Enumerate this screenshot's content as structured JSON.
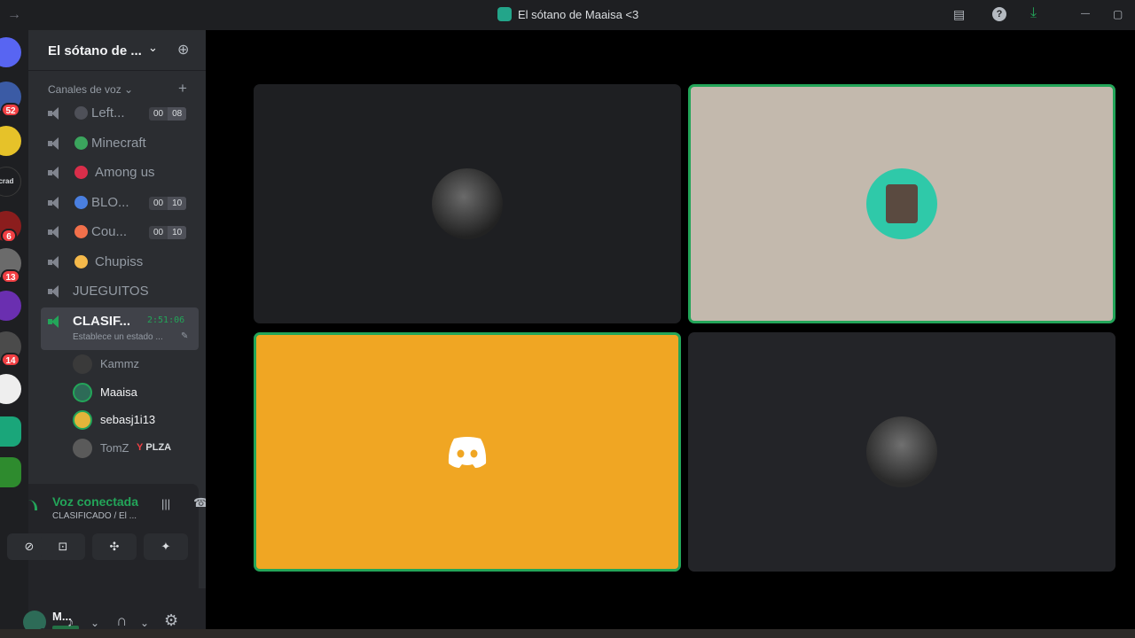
{
  "window": {
    "title": "El sótano de Maaisa <3",
    "back_glyph": "→",
    "inbox_glyph": "▤",
    "help_glyph": "?",
    "download_glyph": "⤓",
    "minimize_glyph": "—",
    "maximize_glyph": "▢"
  },
  "servers": {
    "badges": [
      "52",
      "6",
      "13",
      "14"
    ],
    "partial_label": "ecrad",
    "colors": [
      "#3b5ba5",
      "#e6c229",
      "#8b1d1d",
      "#6b6b6b",
      "#6a2fb0",
      "#4b4b4b",
      "#eeeeee",
      "#1aa67a",
      "#2e8b2e"
    ]
  },
  "server": {
    "name": "El sótano de ...",
    "chevron_glyph": "⌄",
    "invite_glyph": "⊕"
  },
  "sidebar": {
    "category": "Canales de voz ⌄",
    "category_plus": "+",
    "channels": [
      {
        "name": "Left...",
        "emoji_color": "#4e5058",
        "count": "00",
        "limit": "08"
      },
      {
        "name": "Minecraft",
        "emoji_color": "#3ba55d"
      },
      {
        "name": "Among us",
        "emoji_color": "#d92e4a"
      },
      {
        "name": "BLO...",
        "emoji_color": "#4a7fe0",
        "count": "00",
        "limit": "10"
      },
      {
        "name": "Cou...",
        "emoji_color": "#f2704b",
        "count": "00",
        "limit": "10"
      },
      {
        "name": "Chupiss",
        "emoji_color": "#f5b94a"
      },
      {
        "name": "JUEGUITOS"
      },
      {
        "name": "CLASIF...",
        "timer": "2:51:06",
        "status": "Establece un estado ...",
        "pen_glyph": "✎"
      }
    ],
    "users": [
      {
        "name": "Kammz",
        "avatar_color": "#3a3a3a"
      },
      {
        "name": "Maaisa",
        "avatar_color": "#2d6b57"
      },
      {
        "name": "sebasj1i13",
        "avatar_color": "#e3b43a"
      },
      {
        "name": "TomZ",
        "avatar_color": "#5a5a5a",
        "tag_icon": "Y",
        "tag": "PLZA"
      }
    ]
  },
  "voice": {
    "title": "Voz conectada",
    "channel": "CLASIFICADO / El ...",
    "wave_glyph": "|||",
    "hangup_glyph": "☎",
    "buttons": [
      {
        "label": "⊘"
      },
      {
        "label": "⊡"
      },
      {
        "label": "✣"
      },
      {
        "label": "✦"
      }
    ]
  },
  "userbar": {
    "name": "M...",
    "mic_glyph": "♪",
    "headset_glyph": "∩",
    "caret_glyph": "⌄",
    "gear_glyph": "⚙"
  },
  "tiles": [
    {
      "bg": "#1e1f22",
      "speaking": false,
      "avatar_color": "#3c3c3c"
    },
    {
      "bg": "#c3b9ad",
      "speaking": true,
      "avatar_color": "#2fc9a9"
    },
    {
      "bg": "#f0a623",
      "speaking": true,
      "avatar_color": ""
    },
    {
      "bg": "#232428",
      "speaking": false,
      "avatar_color": "#4a4a4a"
    }
  ]
}
